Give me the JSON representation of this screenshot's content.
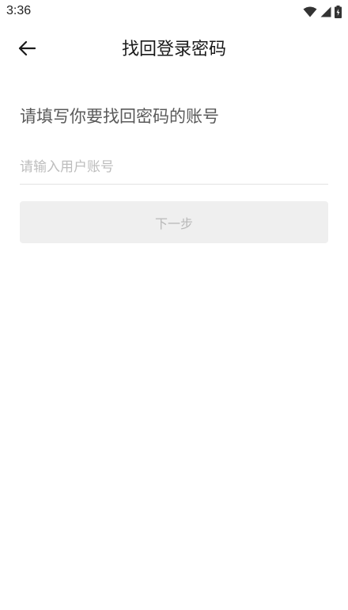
{
  "status_bar": {
    "time": "3:36",
    "icons": [
      "wifi-icon",
      "signal-icon",
      "battery-icon"
    ]
  },
  "header": {
    "title": "找回登录密码",
    "back_icon": "arrow-left-icon"
  },
  "main": {
    "heading": "请填写你要找回密码的账号",
    "account_input": {
      "value": "",
      "placeholder": "请输入用户账号"
    },
    "next_button_label": "下一步"
  },
  "colors": {
    "background": "#ffffff",
    "heading_text": "#5a5a5a",
    "placeholder_text": "#bdbdbd",
    "button_disabled_bg": "#efefef",
    "button_disabled_text": "#b8b8b8"
  }
}
